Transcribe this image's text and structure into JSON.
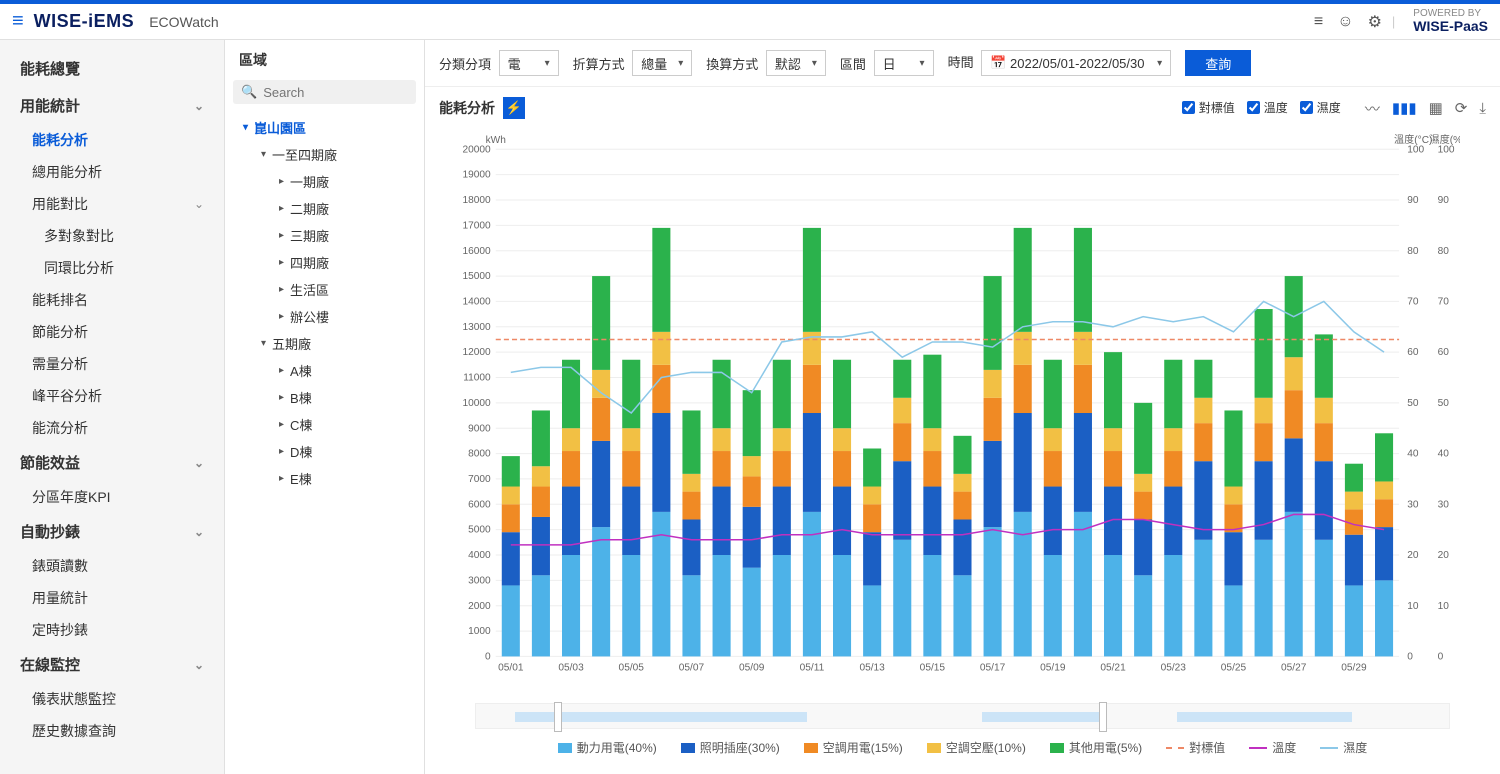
{
  "header": {
    "brand": "WISE-iEMS",
    "subtitle": "ECOWatch",
    "powered_label": "POWERED BY",
    "powered_brand": "WISE-PaaS"
  },
  "sidebar": {
    "groups": [
      {
        "label": "能耗總覽",
        "type": "cat"
      },
      {
        "label": "用能統計",
        "type": "cat",
        "expandable": true
      },
      {
        "label": "能耗分析",
        "type": "item",
        "active": true
      },
      {
        "label": "總用能分析",
        "type": "item"
      },
      {
        "label": "用能對比",
        "type": "item",
        "expandable": true
      },
      {
        "label": "多對象對比",
        "type": "sub"
      },
      {
        "label": "同環比分析",
        "type": "sub"
      },
      {
        "label": "能耗排名",
        "type": "item"
      },
      {
        "label": "節能分析",
        "type": "item"
      },
      {
        "label": "需量分析",
        "type": "item"
      },
      {
        "label": "峰平谷分析",
        "type": "item"
      },
      {
        "label": "能流分析",
        "type": "item"
      },
      {
        "label": "節能效益",
        "type": "cat",
        "expandable": true
      },
      {
        "label": "分區年度KPI",
        "type": "item"
      },
      {
        "label": "自動抄錶",
        "type": "cat",
        "expandable": true
      },
      {
        "label": "錶頭讀數",
        "type": "item"
      },
      {
        "label": "用量統計",
        "type": "item"
      },
      {
        "label": "定時抄錶",
        "type": "item"
      },
      {
        "label": "在線監控",
        "type": "cat",
        "expandable": true
      },
      {
        "label": "儀表狀態監控",
        "type": "item"
      },
      {
        "label": "歷史數據查詢",
        "type": "item"
      }
    ]
  },
  "area": {
    "title": "區域",
    "search_placeholder": "Search",
    "tree": [
      {
        "label": "崑山園區",
        "level": 1,
        "open": true
      },
      {
        "label": "一至四期廠",
        "level": 2,
        "open": true
      },
      {
        "label": "一期廠",
        "level": 3
      },
      {
        "label": "二期廠",
        "level": 3
      },
      {
        "label": "三期廠",
        "level": 3
      },
      {
        "label": "四期廠",
        "level": 3
      },
      {
        "label": "生活區",
        "level": 3
      },
      {
        "label": "辦公樓",
        "level": 3
      },
      {
        "label": "五期廠",
        "level": 2,
        "open": true
      },
      {
        "label": "A棟",
        "level": 3
      },
      {
        "label": "B棟",
        "level": 3
      },
      {
        "label": "C棟",
        "level": 3
      },
      {
        "label": "D棟",
        "level": 3
      },
      {
        "label": "E棟",
        "level": 3
      }
    ]
  },
  "filters": {
    "category_label": "分類分項",
    "category_value": "電",
    "calc_label": "折算方式",
    "calc_value": "總量",
    "convert_label": "換算方式",
    "convert_value": "默認",
    "interval_label": "區間",
    "interval_value": "日",
    "time_label": "時間",
    "time_value": "2022/05/01-2022/05/30",
    "query_button": "查詢"
  },
  "chart_header": {
    "title": "能耗分析",
    "checkboxes": [
      {
        "label": "對標值",
        "checked": true
      },
      {
        "label": "溫度",
        "checked": true
      },
      {
        "label": "濕度",
        "checked": true
      }
    ]
  },
  "legend": [
    {
      "label": "動力用電(40%)",
      "color": "#4db2e8",
      "type": "box"
    },
    {
      "label": "照明插座(30%)",
      "color": "#1b5fc4",
      "type": "box"
    },
    {
      "label": "空調用電(15%)",
      "color": "#f08a24",
      "type": "box"
    },
    {
      "label": "空調空壓(10%)",
      "color": "#f2c044",
      "type": "box"
    },
    {
      "label": "其他用電(5%)",
      "color": "#2bb24c",
      "type": "box"
    },
    {
      "label": "對標值",
      "color": "#e86",
      "type": "dash"
    },
    {
      "label": "溫度",
      "color": "#c030c0",
      "type": "line"
    },
    {
      "label": "濕度",
      "color": "#8cc8e8",
      "type": "line"
    }
  ],
  "chart_data": {
    "type": "bar",
    "title": "能耗分析",
    "ylabel_left": "kWh",
    "ylabel_right_1": "溫度(°C)",
    "ylabel_right_2": "濕度(%)",
    "ylim_left": [
      0,
      20000
    ],
    "ylim_right": [
      0,
      100
    ],
    "baseline": 12500,
    "categories": [
      "05/01",
      "05/02",
      "05/03",
      "05/04",
      "05/05",
      "05/06",
      "05/07",
      "05/08",
      "05/09",
      "05/10",
      "05/11",
      "05/12",
      "05/13",
      "05/14",
      "05/15",
      "05/16",
      "05/17",
      "05/18",
      "05/19",
      "05/20",
      "05/21",
      "05/22",
      "05/23",
      "05/24",
      "05/25",
      "05/26",
      "05/27",
      "05/28",
      "05/29",
      "05/30"
    ],
    "series": [
      {
        "name": "動力用電(40%)",
        "color": "#4db2e8",
        "values": [
          2800,
          3200,
          4000,
          5100,
          4000,
          5700,
          3200,
          4000,
          3500,
          4000,
          5700,
          4000,
          2800,
          4600,
          4000,
          3200,
          5100,
          5700,
          4000,
          5700,
          4000,
          3200,
          4000,
          4600,
          2800,
          4600,
          5700,
          4600,
          2800,
          3000
        ]
      },
      {
        "name": "照明插座(30%)",
        "color": "#1b5fc4",
        "values": [
          2100,
          2300,
          2700,
          3400,
          2700,
          3900,
          2200,
          2700,
          2400,
          2700,
          3900,
          2700,
          2100,
          3100,
          2700,
          2200,
          3400,
          3900,
          2700,
          3900,
          2700,
          2200,
          2700,
          3100,
          2100,
          3100,
          2900,
          3100,
          2000,
          2100
        ]
      },
      {
        "name": "空調用電(15%)",
        "color": "#f08a24",
        "values": [
          1100,
          1200,
          1400,
          1700,
          1400,
          1900,
          1100,
          1400,
          1200,
          1400,
          1900,
          1400,
          1100,
          1500,
          1400,
          1100,
          1700,
          1900,
          1400,
          1900,
          1400,
          1100,
          1400,
          1500,
          1100,
          1500,
          1900,
          1500,
          1000,
          1100
        ]
      },
      {
        "name": "空調空壓(10%)",
        "color": "#f2c044",
        "values": [
          700,
          800,
          900,
          1100,
          900,
          1300,
          700,
          900,
          800,
          900,
          1300,
          900,
          700,
          1000,
          900,
          700,
          1100,
          1300,
          900,
          1300,
          900,
          700,
          900,
          1000,
          700,
          1000,
          1300,
          1000,
          700,
          700
        ]
      },
      {
        "name": "其他用電(5%)",
        "color": "#2bb24c",
        "values": [
          1200,
          2200,
          2700,
          3700,
          2700,
          4100,
          2500,
          2700,
          2600,
          2700,
          4100,
          2700,
          1500,
          1500,
          2900,
          1500,
          3700,
          4100,
          2700,
          4100,
          3000,
          2800,
          2700,
          1500,
          3000,
          3500,
          3200,
          2500,
          1100,
          1900
        ]
      }
    ],
    "temp": [
      22,
      22,
      22,
      23,
      23,
      24,
      23,
      23,
      23,
      24,
      24,
      25,
      24,
      24,
      24,
      24,
      25,
      24,
      25,
      25,
      27,
      27,
      26,
      25,
      25,
      26,
      28,
      28,
      26,
      25
    ],
    "humid": [
      56,
      57,
      57,
      52,
      48,
      55,
      56,
      56,
      52,
      62,
      63,
      63,
      64,
      59,
      62,
      62,
      61,
      65,
      66,
      66,
      65,
      67,
      66,
      67,
      64,
      70,
      67,
      70,
      64,
      60
    ]
  }
}
